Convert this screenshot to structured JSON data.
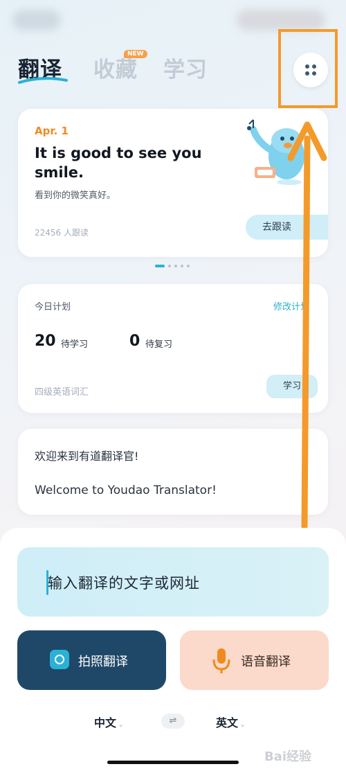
{
  "tabs": [
    {
      "label": "翻译",
      "active": true
    },
    {
      "label": "收藏",
      "badge": "NEW"
    },
    {
      "label": "学习"
    }
  ],
  "daily": {
    "date": "Apr. 1",
    "quote_en": "It is good to see you smile.",
    "quote_cn": "看到你的微笑真好。",
    "readers": "22456 人跟读",
    "follow_label": "去跟读"
  },
  "plan": {
    "title": "今日计划",
    "edit_label": "修改计划",
    "to_learn_count": "20",
    "to_learn_label": "待学习",
    "to_review_count": "0",
    "to_review_label": "待复习",
    "vocab": "四级英语词汇",
    "study_label": "学习"
  },
  "welcome": {
    "cn": "欢迎来到有道翻译官!",
    "en": "Welcome to Youdao Translator!"
  },
  "translate": {
    "input_placeholder": "输入翻译的文字或网址",
    "photo_label": "拍照翻译",
    "voice_label": "语音翻译",
    "source_lang": "中文",
    "target_lang": "英文",
    "swap_glyph": "⇌"
  },
  "watermark": "Bai经验",
  "colors": {
    "accent": "#2ab1d6",
    "highlight": "#f49a2a",
    "photo_button": "#1f4868",
    "voice_button": "#fbd9cb"
  },
  "icons": [
    "more-dots-icon",
    "camera-icon",
    "microphone-icon",
    "chevron-right-icon",
    "chevron-down-icon",
    "swap-icon"
  ]
}
